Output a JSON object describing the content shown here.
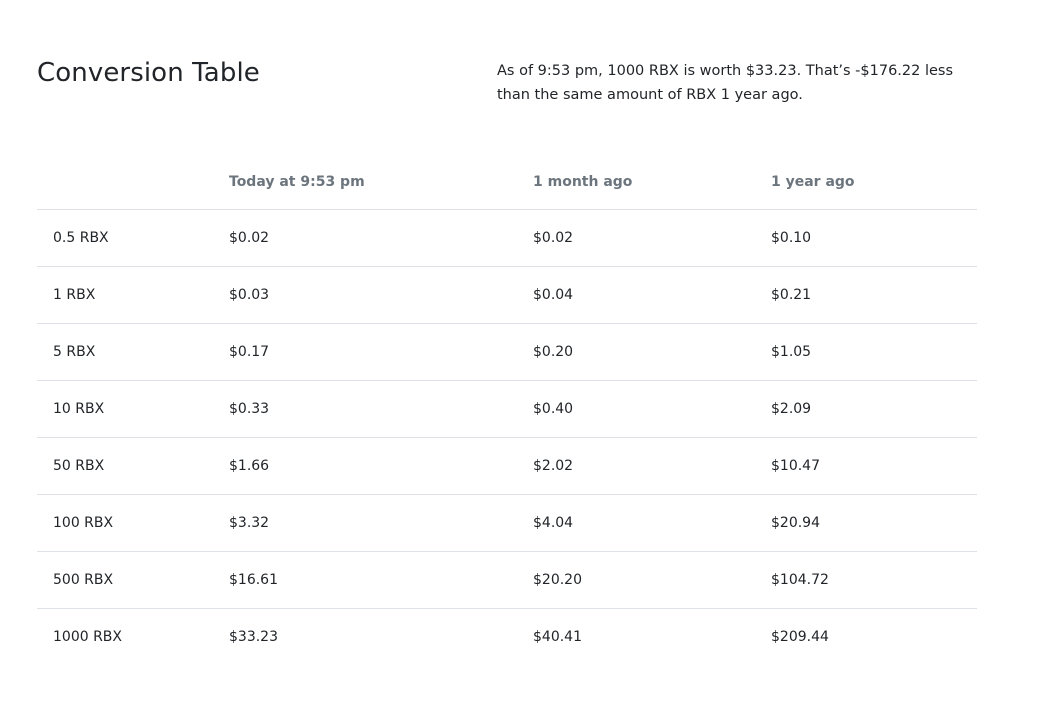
{
  "heading": {
    "title": "Conversion Table",
    "summary": "As of 9:53 pm, 1000 RBX is worth $33.23. That’s -$176.22 less than the same amount of RBX 1 year ago."
  },
  "table": {
    "columns": [
      "",
      "Today at 9:53 pm",
      "1 month ago",
      "1 year ago"
    ],
    "rows": [
      {
        "amount": "0.5 RBX",
        "today": "$0.02",
        "month_ago": "$0.02",
        "year_ago": "$0.10"
      },
      {
        "amount": "1 RBX",
        "today": "$0.03",
        "month_ago": "$0.04",
        "year_ago": "$0.21"
      },
      {
        "amount": "5 RBX",
        "today": "$0.17",
        "month_ago": "$0.20",
        "year_ago": "$1.05"
      },
      {
        "amount": "10 RBX",
        "today": "$0.33",
        "month_ago": "$0.40",
        "year_ago": "$2.09"
      },
      {
        "amount": "50 RBX",
        "today": "$1.66",
        "month_ago": "$2.02",
        "year_ago": "$10.47"
      },
      {
        "amount": "100 RBX",
        "today": "$3.32",
        "month_ago": "$4.04",
        "year_ago": "$20.94"
      },
      {
        "amount": "500 RBX",
        "today": "$16.61",
        "month_ago": "$20.20",
        "year_ago": "$104.72"
      },
      {
        "amount": "1000 RBX",
        "today": "$33.23",
        "month_ago": "$40.41",
        "year_ago": "$209.44"
      }
    ]
  },
  "colors": {
    "text": "#212529",
    "muted_header": "#6c757d",
    "divider": "#dee2e6",
    "background": "#ffffff"
  }
}
